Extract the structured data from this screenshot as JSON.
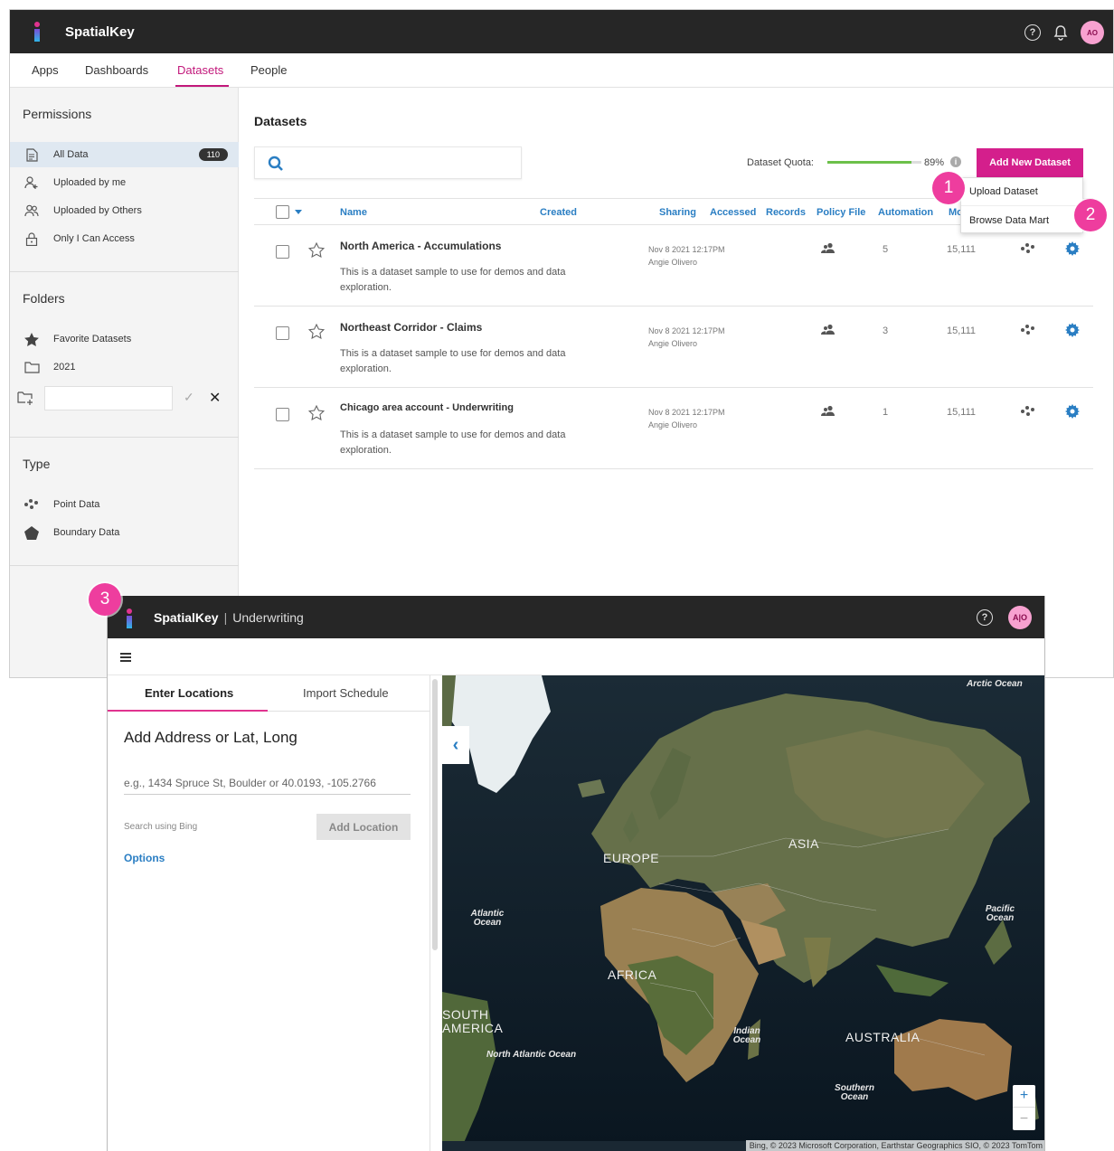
{
  "back": {
    "brand": "SpatialKey",
    "avatar": "AO",
    "nav": [
      "Apps",
      "Dashboards",
      "Datasets",
      "People"
    ],
    "sidebar": {
      "permissions_title": "Permissions",
      "permissions": [
        {
          "label": "All Data",
          "count": "110"
        },
        {
          "label": "Uploaded by me"
        },
        {
          "label": "Uploaded by Others"
        },
        {
          "label": "Only I Can Access"
        }
      ],
      "folders_title": "Folders",
      "folders": [
        "Favorite Datasets",
        "2021"
      ],
      "type_title": "Type",
      "types": [
        "Point Data",
        "Boundary Data"
      ]
    },
    "main": {
      "title": "Datasets",
      "quota_label": "Dataset Quota:",
      "quota_percent": "89%",
      "quota_value": 0.89,
      "add_button": "Add New Dataset",
      "dropdown": [
        "Upload Dataset",
        "Browse Data Mart"
      ],
      "columns": [
        "Name",
        "Created",
        "Sharing",
        "Accessed",
        "Records",
        "Policy File",
        "Automation",
        "Mo"
      ],
      "rows": [
        {
          "name": "North America - Accumulations",
          "desc": "This is a dataset sample to use for demos and data exploration.",
          "created": "Nov 8 2021 12:17PM",
          "owner": "Angie Olivero",
          "automation": "5",
          "records": "15,111"
        },
        {
          "name": "Northeast Corridor - Claims",
          "desc": "This is a dataset sample to use for demos and data exploration.",
          "created": "Nov 8 2021 12:17PM",
          "owner": "Angie Olivero",
          "automation": "3",
          "records": "15,111"
        },
        {
          "name": "Chicago area account - Underwriting",
          "desc": "This is a dataset sample to use for demos and data exploration.",
          "created": "Nov 8 2021 12:17PM",
          "owner": "Angie Olivero",
          "automation": "1",
          "records": "15,111"
        }
      ]
    }
  },
  "callouts": [
    "1",
    "2",
    "3"
  ],
  "front": {
    "brand": "SpatialKey",
    "separator": "|",
    "product": "Underwriting",
    "avatar": "A|O",
    "tabs": [
      "Enter Locations",
      "Import Schedule"
    ],
    "heading": "Add Address or Lat, Long",
    "placeholder": "e.g., 1434 Spruce St, Boulder or 40.0193, -105.2766",
    "bing_label": "Search using Bing",
    "add_location": "Add Location",
    "options": "Options",
    "map": {
      "oceans": [
        "Arctic Ocean",
        "Atlantic Ocean",
        "Pacific Ocean",
        "Indian Ocean",
        "North Atlantic Ocean",
        "Southern Ocean"
      ],
      "continents": [
        "EUROPE",
        "ASIA",
        "AFRICA",
        "SOUTH AMERICA",
        "AUSTRALIA"
      ],
      "attribution": "Bing, © 2023 Microsoft Corporation, Earthstar Geographics SIO, © 2023 TomTom"
    }
  },
  "colors": {
    "accent": "#d41f8c",
    "link": "#2a7ec3",
    "callout": "#ee3d9e",
    "quota": "#6cc04a"
  }
}
